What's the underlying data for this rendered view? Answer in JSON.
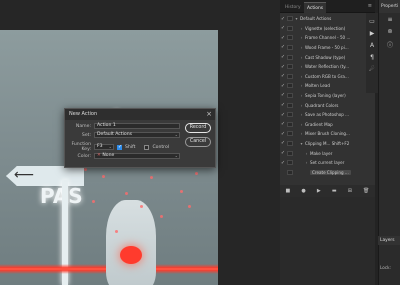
{
  "panels": {
    "tabs": [
      "History",
      "Actions"
    ],
    "active_tab": "Actions",
    "properties_title": "Properti",
    "layers_title": "Layers",
    "kind_label": "Lock:",
    "panel_menu_icon": "menu-icon"
  },
  "actions_list": [
    {
      "check": "✓",
      "indent": 0,
      "text": "Default Actions",
      "expand": "▾"
    },
    {
      "check": "✓",
      "indent": 1,
      "text": "Vignette (selection)",
      "expand": "›"
    },
    {
      "check": "✓",
      "indent": 1,
      "text": "Frame Channel - 50 ...",
      "expand": "›"
    },
    {
      "check": "✓",
      "indent": 1,
      "text": "Wood Frame - 50 pi...",
      "expand": "›"
    },
    {
      "check": "✓",
      "indent": 1,
      "text": "Cast Shadow (type)",
      "expand": "›"
    },
    {
      "check": "✓",
      "indent": 1,
      "text": "Water Reflection (ty...",
      "expand": "›"
    },
    {
      "check": "✓",
      "indent": 1,
      "text": "Custom RGB to Gra...",
      "expand": "›"
    },
    {
      "check": "✓",
      "indent": 1,
      "text": "Molten Lead",
      "expand": "›"
    },
    {
      "check": "✓",
      "indent": 1,
      "text": "Sepia Toning (layer)",
      "expand": "›"
    },
    {
      "check": "✓",
      "indent": 1,
      "text": "Quadrant Colors",
      "expand": "›"
    },
    {
      "check": "✓",
      "indent": 1,
      "text": "Save as Photoshop ...",
      "expand": "›"
    },
    {
      "check": "✓",
      "indent": 1,
      "text": "Gradient Map",
      "expand": "›"
    },
    {
      "check": "✓",
      "indent": 1,
      "text": "Mixer Brush Cloning...",
      "expand": "›"
    },
    {
      "check": "✓",
      "indent": 1,
      "text": "Clipping M... Shift+F2",
      "expand": "▾"
    },
    {
      "check": "✓",
      "indent": 2,
      "text": "Make layer",
      "expand": "›"
    },
    {
      "check": "✓",
      "indent": 2,
      "text": "Set current layer",
      "expand": "›"
    },
    {
      "check": "",
      "indent": 2,
      "text": "Create Clipping ...",
      "expand": "",
      "selected": true
    }
  ],
  "action_toolbar": [
    "■",
    "●",
    "▶",
    "▬",
    "⊞",
    "🗑"
  ],
  "dialog": {
    "title": "New Action",
    "close": "×",
    "name_label": "Name:",
    "name_value": "Action 1",
    "set_label": "Set:",
    "set_value": "Default Actions",
    "fkey_label": "Function Key:",
    "fkey_value": "F3",
    "shift_label": "Shift",
    "shift_checked": true,
    "control_label": "Control",
    "control_checked": false,
    "color_label": "Color:",
    "color_value": "None",
    "color_swatch": "✕",
    "record_label": "Record",
    "cancel_label": "Cancel"
  },
  "canvas": {
    "sign_glyph": "⟵",
    "sign_text": "PAS"
  },
  "side_tools": [
    "▭",
    "▶",
    "A",
    "¶",
    "☄"
  ],
  "props_icons": [
    "≡",
    "⊚",
    "ⓘ"
  ]
}
